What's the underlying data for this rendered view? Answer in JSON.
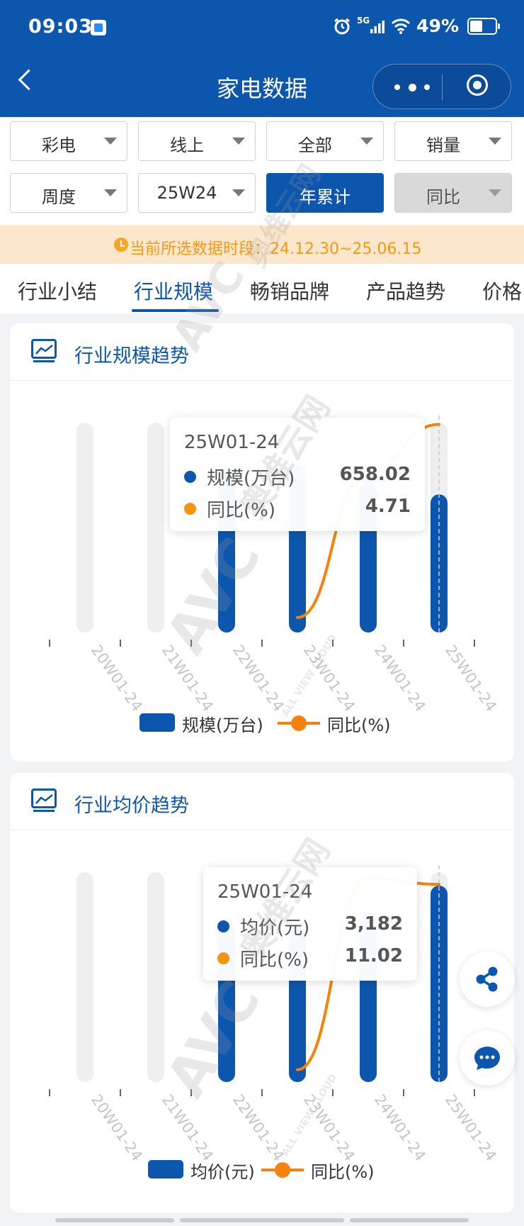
{
  "status": {
    "time": "09:03",
    "network": "5G",
    "battery": "49%"
  },
  "header": {
    "title": "家电数据"
  },
  "filters": {
    "row1": [
      "彩电",
      "线上",
      "全部",
      "销量"
    ],
    "row2": [
      {
        "label": "周度",
        "state": "normal"
      },
      {
        "label": "25W24",
        "state": "normal"
      },
      {
        "label": "年累计",
        "state": "active"
      },
      {
        "label": "同比",
        "state": "disabled"
      }
    ]
  },
  "notice": {
    "text": "当前所选数据时段：24.12.30~25.06.15"
  },
  "tabs": [
    "行业小结",
    "行业规模",
    "畅销品牌",
    "产品趋势",
    "价格"
  ],
  "active_tab": 1,
  "colors": {
    "primary": "#0d56ad",
    "line": "#f5820e",
    "track": "#efefef",
    "notice_bg": "#fde7cc",
    "notice_text": "#f29a14"
  },
  "watermark": {
    "logo": "AVC",
    "brand": "奥维云网",
    "tagline": "ALL VIEW CLOUD"
  },
  "chart_data": [
    {
      "type": "bar",
      "card_title": "行业规模趋势",
      "categories": [
        "20W01-24",
        "21W01-24",
        "22W01-24",
        "23W01-24",
        "24W01-24",
        "25W01-24"
      ],
      "series": [
        {
          "name": "规模(万台)",
          "kind": "bar",
          "values": [
            null,
            null,
            780,
            800,
            720,
            658.02
          ]
        },
        {
          "name": "同比(%)",
          "kind": "line",
          "values": [
            null,
            null,
            null,
            -27.5,
            -3.0,
            4.71
          ]
        }
      ],
      "bar_max": 1000,
      "line_range": [
        -30,
        5
      ],
      "grid": false,
      "legend": "bottom",
      "tooltip": {
        "title": "25W01-24",
        "rows": [
          {
            "name": "规模(万台)",
            "value": "658.02",
            "color": "#0d56ad"
          },
          {
            "name": "同比(%)",
            "value": "4.71",
            "color": "#f5940f"
          }
        ]
      }
    },
    {
      "type": "bar",
      "card_title": "行业均价趋势",
      "categories": [
        "20W01-24",
        "21W01-24",
        "22W01-24",
        "23W01-24",
        "24W01-24",
        "25W01-24"
      ],
      "series": [
        {
          "name": "均价(元)",
          "kind": "bar",
          "values": [
            null,
            null,
            2600,
            2450,
            2750,
            3182
          ]
        },
        {
          "name": "同比(%)",
          "kind": "line",
          "values": [
            null,
            null,
            null,
            -4.0,
            11.5,
            11.02
          ]
        }
      ],
      "bar_max": 3400,
      "line_range": [
        -5,
        12
      ],
      "grid": false,
      "legend": "bottom",
      "tooltip": {
        "title": "25W01-24",
        "rows": [
          {
            "name": "均价(元)",
            "value": "3,182",
            "color": "#0d56ad"
          },
          {
            "name": "同比(%)",
            "value": "11.02",
            "color": "#f5940f"
          }
        ]
      }
    }
  ],
  "fabs": [
    {
      "icon": "share-icon"
    },
    {
      "icon": "chat-bubble-icon"
    }
  ]
}
